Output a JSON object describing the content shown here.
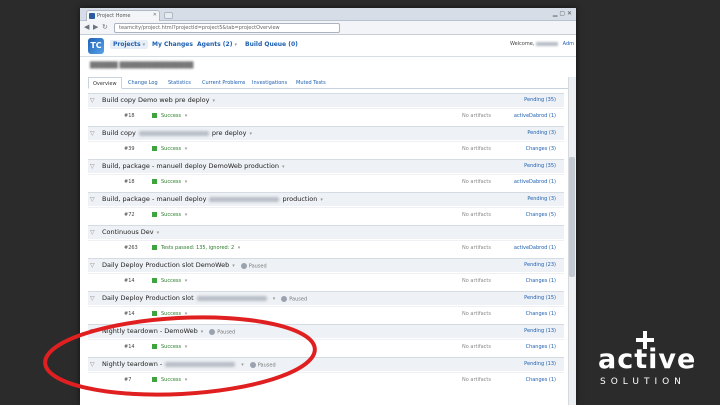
{
  "browser": {
    "tab_title": "Project Home",
    "url": "teamcity/project.html?projectId=project5&tab=projectOverview"
  },
  "nav": {
    "projects": "Projects",
    "my_changes": "My Changes",
    "agents": "Agents (2)",
    "build_queue": "Build Queue (0)",
    "welcome": "Welcome,",
    "admin": "Adm"
  },
  "subtabs": [
    "Overview",
    "Change Log",
    "Statistics",
    "Current Problems",
    "Investigations",
    "Muted Tests"
  ],
  "projects": [
    {
      "name_pre": "Build copy Demo web pre deploy",
      "name_post": "",
      "blurred": false,
      "paused": false,
      "pending": "Pending (35)",
      "build": {
        "num": "#18",
        "status": "Success",
        "status_extra": "",
        "artifacts": "No artifacts",
        "changes": "activeDabrod (1)"
      }
    },
    {
      "name_pre": "Build copy",
      "name_post": "pre deploy",
      "blurred": true,
      "paused": false,
      "pending": "Pending (3)",
      "build": {
        "num": "#39",
        "status": "Success",
        "status_extra": "",
        "artifacts": "No artifacts",
        "changes": "Changes (3)"
      }
    },
    {
      "name_pre": "Build, package - manuell deploy DemoWeb production",
      "name_post": "",
      "blurred": false,
      "paused": false,
      "pending": "Pending (35)",
      "build": {
        "num": "#18",
        "status": "Success",
        "status_extra": "",
        "artifacts": "No artifacts",
        "changes": "activeDabrod (1)"
      }
    },
    {
      "name_pre": "Build, package - manuell deploy",
      "name_post": "production",
      "blurred": true,
      "paused": false,
      "pending": "Pending (3)",
      "build": {
        "num": "#72",
        "status": "Success",
        "status_extra": "",
        "artifacts": "No artifacts",
        "changes": "Changes (5)"
      }
    },
    {
      "name_pre": "Continuous Dev",
      "name_post": "",
      "blurred": false,
      "paused": false,
      "pending": "",
      "build": {
        "num": "#263",
        "status": "Tests passed: 135, ignored: 2",
        "status_extra": "",
        "artifacts": "No artifacts",
        "changes": "activeDabrod (1)"
      }
    },
    {
      "name_pre": "Daily Deploy Production slot DemoWeb",
      "name_post": "",
      "blurred": false,
      "paused": true,
      "paused_label": "Paused",
      "pending": "Pending (23)",
      "build": {
        "num": "#14",
        "status": "Success",
        "status_extra": "",
        "artifacts": "No artifacts",
        "changes": "Changes (1)"
      }
    },
    {
      "name_pre": "Daily Deploy Production slot",
      "name_post": "",
      "blurred": true,
      "paused": true,
      "paused_label": "Paused",
      "pending": "Pending (15)",
      "build": {
        "num": "#14",
        "status": "Success",
        "status_extra": "",
        "artifacts": "No artifacts",
        "changes": "Changes (1)"
      }
    },
    {
      "name_pre": "Nightly teardown - DemoWeb",
      "name_post": "",
      "blurred": false,
      "paused": true,
      "paused_label": "Paused",
      "pending": "Pending (13)",
      "build": {
        "num": "#14",
        "status": "Success",
        "status_extra": "",
        "artifacts": "No artifacts",
        "changes": "Changes (1)"
      }
    },
    {
      "name_pre": "Nightly teardown -",
      "name_post": "",
      "blurred": true,
      "paused": true,
      "paused_label": "Paused",
      "pending": "Pending (13)",
      "build": {
        "num": "#7",
        "status": "Success",
        "status_extra": "",
        "artifacts": "No artifacts",
        "changes": "Changes (1)"
      }
    }
  ],
  "branding": {
    "word": "active",
    "sub": "SOLUTION"
  },
  "colors": {
    "background": "#2b2b2b",
    "highlight_oval": "#e02020",
    "success": "#3ea43e",
    "link": "#1d5fb0"
  }
}
